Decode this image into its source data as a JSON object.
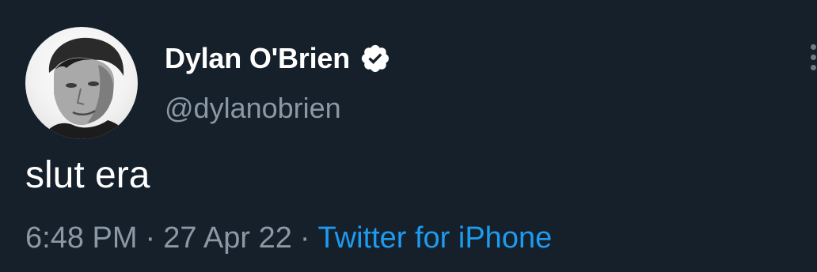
{
  "user": {
    "display_name": "Dylan O'Brien",
    "handle": "@dylanobrien",
    "verified": true
  },
  "tweet": {
    "text": "slut era",
    "time": "6:48 PM",
    "date": "27 Apr 22",
    "source": "Twitter for iPhone",
    "separator": "·"
  },
  "icons": {
    "verified": "verified-badge-icon",
    "more": "more-options-icon"
  },
  "colors": {
    "background": "#15202b",
    "primary_text": "#ffffff",
    "secondary_text": "#8b98a5",
    "link": "#1d9bf0"
  }
}
